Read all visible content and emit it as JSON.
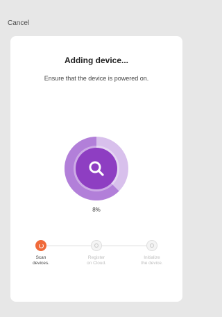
{
  "header": {
    "cancel_label": "Cancel"
  },
  "card": {
    "title": "Adding device...",
    "subtitle": "Ensure that the device is powered on.",
    "progress_text": "8%",
    "progress": 0.08,
    "icon": "search-icon"
  },
  "steps": [
    {
      "label": "Scan\ndevices.",
      "state": "active",
      "icon": "spinner-icon"
    },
    {
      "label": "Register\non Cloud.",
      "state": "inactive",
      "icon": "cloud-icon"
    },
    {
      "label": "Initialize\nthe device.",
      "state": "inactive",
      "icon": "device-icon"
    }
  ],
  "colors": {
    "accent_purple": "#8e3ec2",
    "ring_light": "#c9a7e4",
    "active_step": "#f06a3a"
  }
}
